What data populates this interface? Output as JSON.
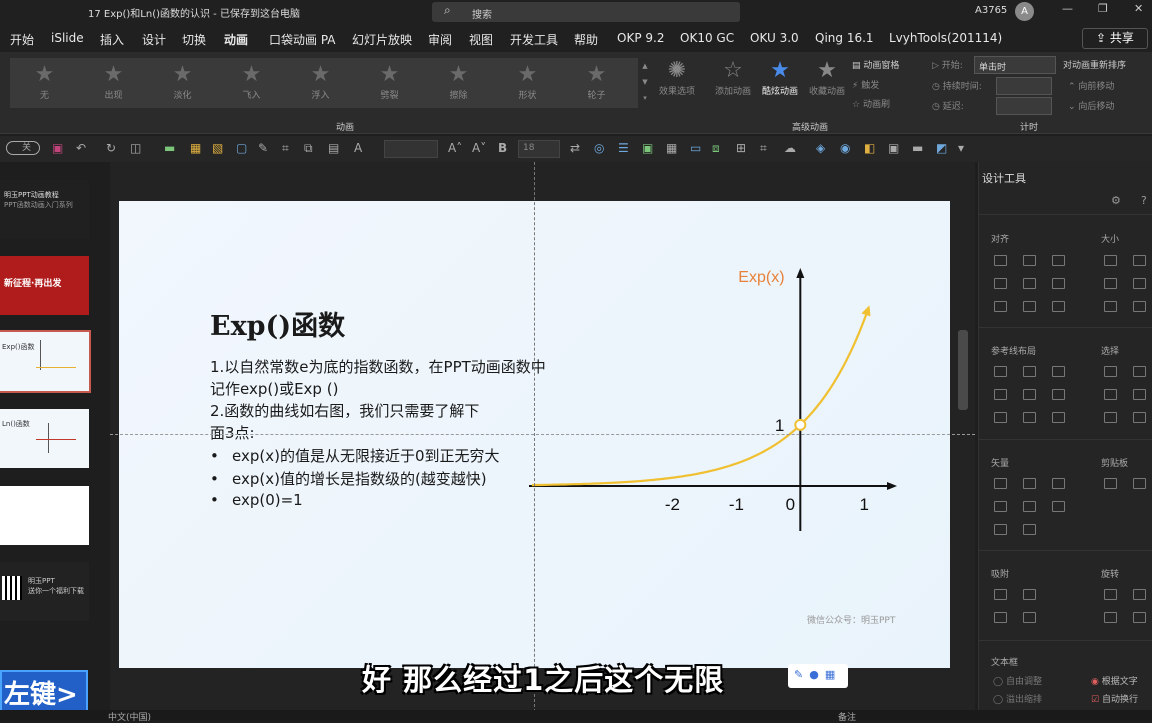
{
  "titlebar": {
    "document": "17 Exp()和Ln()函数的认识 - 已保存到这台电脑",
    "search_placeholder": "搜索",
    "user": "A3765",
    "avatar": "A",
    "minimize": "—",
    "restore": "❐",
    "close": "✕"
  },
  "menu": {
    "items": [
      "开始",
      "iSlide",
      "插入",
      "设计",
      "切换",
      "动画",
      "口袋动画 PA",
      "幻灯片放映",
      "审阅",
      "视图",
      "开发工具",
      "帮助",
      "OKP 9.2",
      "OK10 GC",
      "OKU 3.0",
      "Qing 16.1",
      "LvyhTools(201114)"
    ],
    "active": "动画",
    "share": "共享"
  },
  "ribbon": {
    "animations": [
      "无",
      "出现",
      "淡化",
      "飞入",
      "浮入",
      "劈裂",
      "擦除",
      "形状",
      "轮子"
    ],
    "effect_options": "效果选项",
    "add_animation": "添加动画",
    "cool_animation": "酷炫动画",
    "favorites": "收藏动画",
    "pane": "动画窗格",
    "trigger": "触发",
    "painter": "动画刷",
    "group_animation": "动画",
    "group_advanced": "高级动画",
    "group_timing": "计时",
    "start_label": "开始:",
    "start_value": "单击时",
    "duration_label": "持续时间:",
    "delay_label": "延迟:",
    "reorder": "对动画重新排序",
    "move_earlier": "向前移动",
    "move_later": "向后移动"
  },
  "toolbar": {
    "toggle": "关",
    "bold": "B",
    "font_size": "18"
  },
  "thumbnails": [
    {
      "lines": [
        "明玉PPT动画教程",
        "PPT函数动画入门系列"
      ]
    },
    {
      "lines": [
        "新征程·再出发"
      ]
    },
    {
      "lines": [
        "Exp()函数"
      ]
    },
    {
      "lines": [
        "Ln()函数"
      ]
    },
    {
      "lines": [
        ""
      ]
    },
    {
      "lines": [
        "明玉PPT",
        "送你一个福利下载"
      ]
    }
  ],
  "mouse_indicator": "左键>",
  "slide": {
    "heading": "Exp()函数",
    "para1": "1.以自然常数e为底的指数函数，在PPT动画函数中",
    "para1b": "记作exp()或Exp ()",
    "para2": "2.函数的曲线如右图，我们只需要了解下",
    "para2b": "面3点:",
    "bullets": [
      "exp(x)的值是从无限接近于0到正无穷大",
      "exp(x)值的增长是指数级的(越变越快)",
      "exp(0)=1"
    ],
    "bullet_symbol": "•",
    "footer": "微信公众号：明玉PPT"
  },
  "chart_data": {
    "type": "line",
    "title": "Exp(x)",
    "xlabel": "",
    "ylabel": "Exp(x)",
    "xlim": [
      -4.4,
      1.7
    ],
    "ylim": [
      0,
      3.6
    ],
    "x_ticks": [
      -2,
      -1,
      0,
      1
    ],
    "y_ticks": [
      1
    ],
    "highlighted_point": {
      "x": 0,
      "y": 1
    },
    "color": "#f0c030",
    "label_color": "#e8823a",
    "series": [
      {
        "function": "exp(x)",
        "x_start": -4.2,
        "x_end": 1.05
      }
    ]
  },
  "panel": {
    "title": "设计工具",
    "sections": [
      "对齐",
      "大小",
      "参考线布局",
      "选择",
      "矢量",
      "剪贴板",
      "吸附",
      "旋转",
      "文本框"
    ],
    "opts": [
      "自由调整",
      "溢出缩排",
      "根据文字",
      "自动换行"
    ]
  },
  "subtitle": "好 那么经过1之后这个无限",
  "status": {
    "language": "中文(中国)",
    "notes": "备注"
  }
}
